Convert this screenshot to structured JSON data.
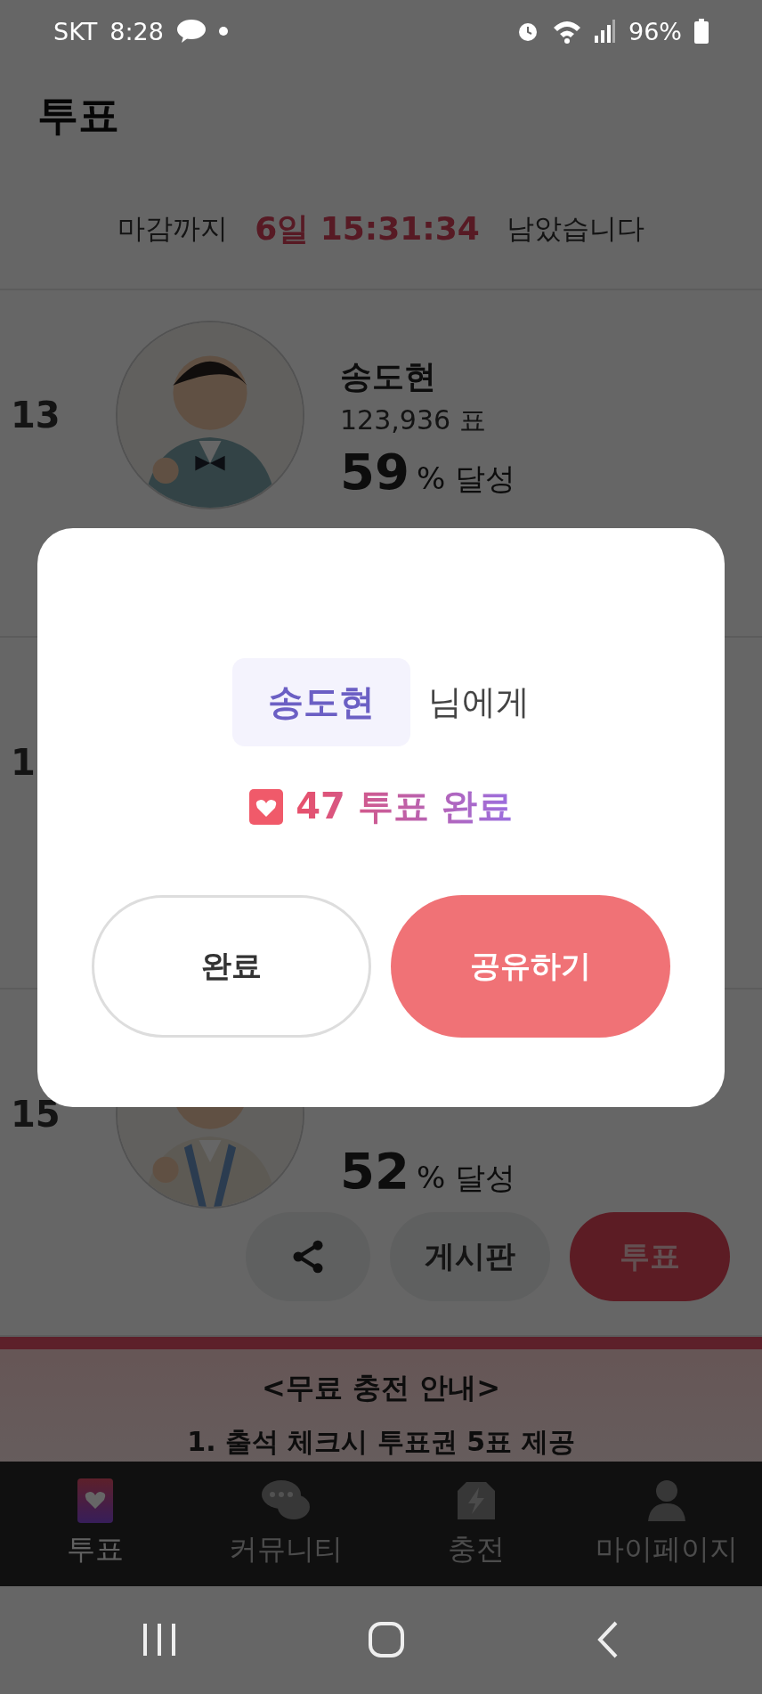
{
  "status_bar": {
    "carrier": "SKT",
    "time": "8:28",
    "battery": "96%"
  },
  "header": {
    "title": "투표"
  },
  "countdown": {
    "prefix": "마감까지",
    "remaining": "6일 15:31:34",
    "suffix": "남았습니다"
  },
  "candidates": [
    {
      "rank": "13",
      "name": "송도현",
      "votes": "123,936 표",
      "percent": "59",
      "percent_suffix": "% 달성"
    },
    {
      "rank": "1"
    },
    {
      "rank": "15",
      "percent": "52",
      "percent_suffix": "% 달성",
      "actions": [
        {
          "kind": "share"
        },
        {
          "kind": "board",
          "label": "게시판"
        },
        {
          "kind": "vote",
          "label": "투표"
        }
      ]
    }
  ],
  "banner": {
    "title": "<무료 충전 안내>",
    "lines": [
      "1. 출석 체크시 투표권 5표 제공"
    ]
  },
  "bottom_nav": [
    {
      "label": "투표",
      "selected": true
    },
    {
      "label": "커뮤니티",
      "selected": false
    },
    {
      "label": "충전",
      "selected": false
    },
    {
      "label": "마이페이지",
      "selected": false
    }
  ],
  "dialog": {
    "recipient": "송도현",
    "recipient_suffix": "님에게",
    "result": "47 투표 완료",
    "buttons": [
      {
        "kind": "secondary",
        "label": "완료"
      },
      {
        "kind": "primary",
        "label": "공유하기"
      }
    ]
  }
}
